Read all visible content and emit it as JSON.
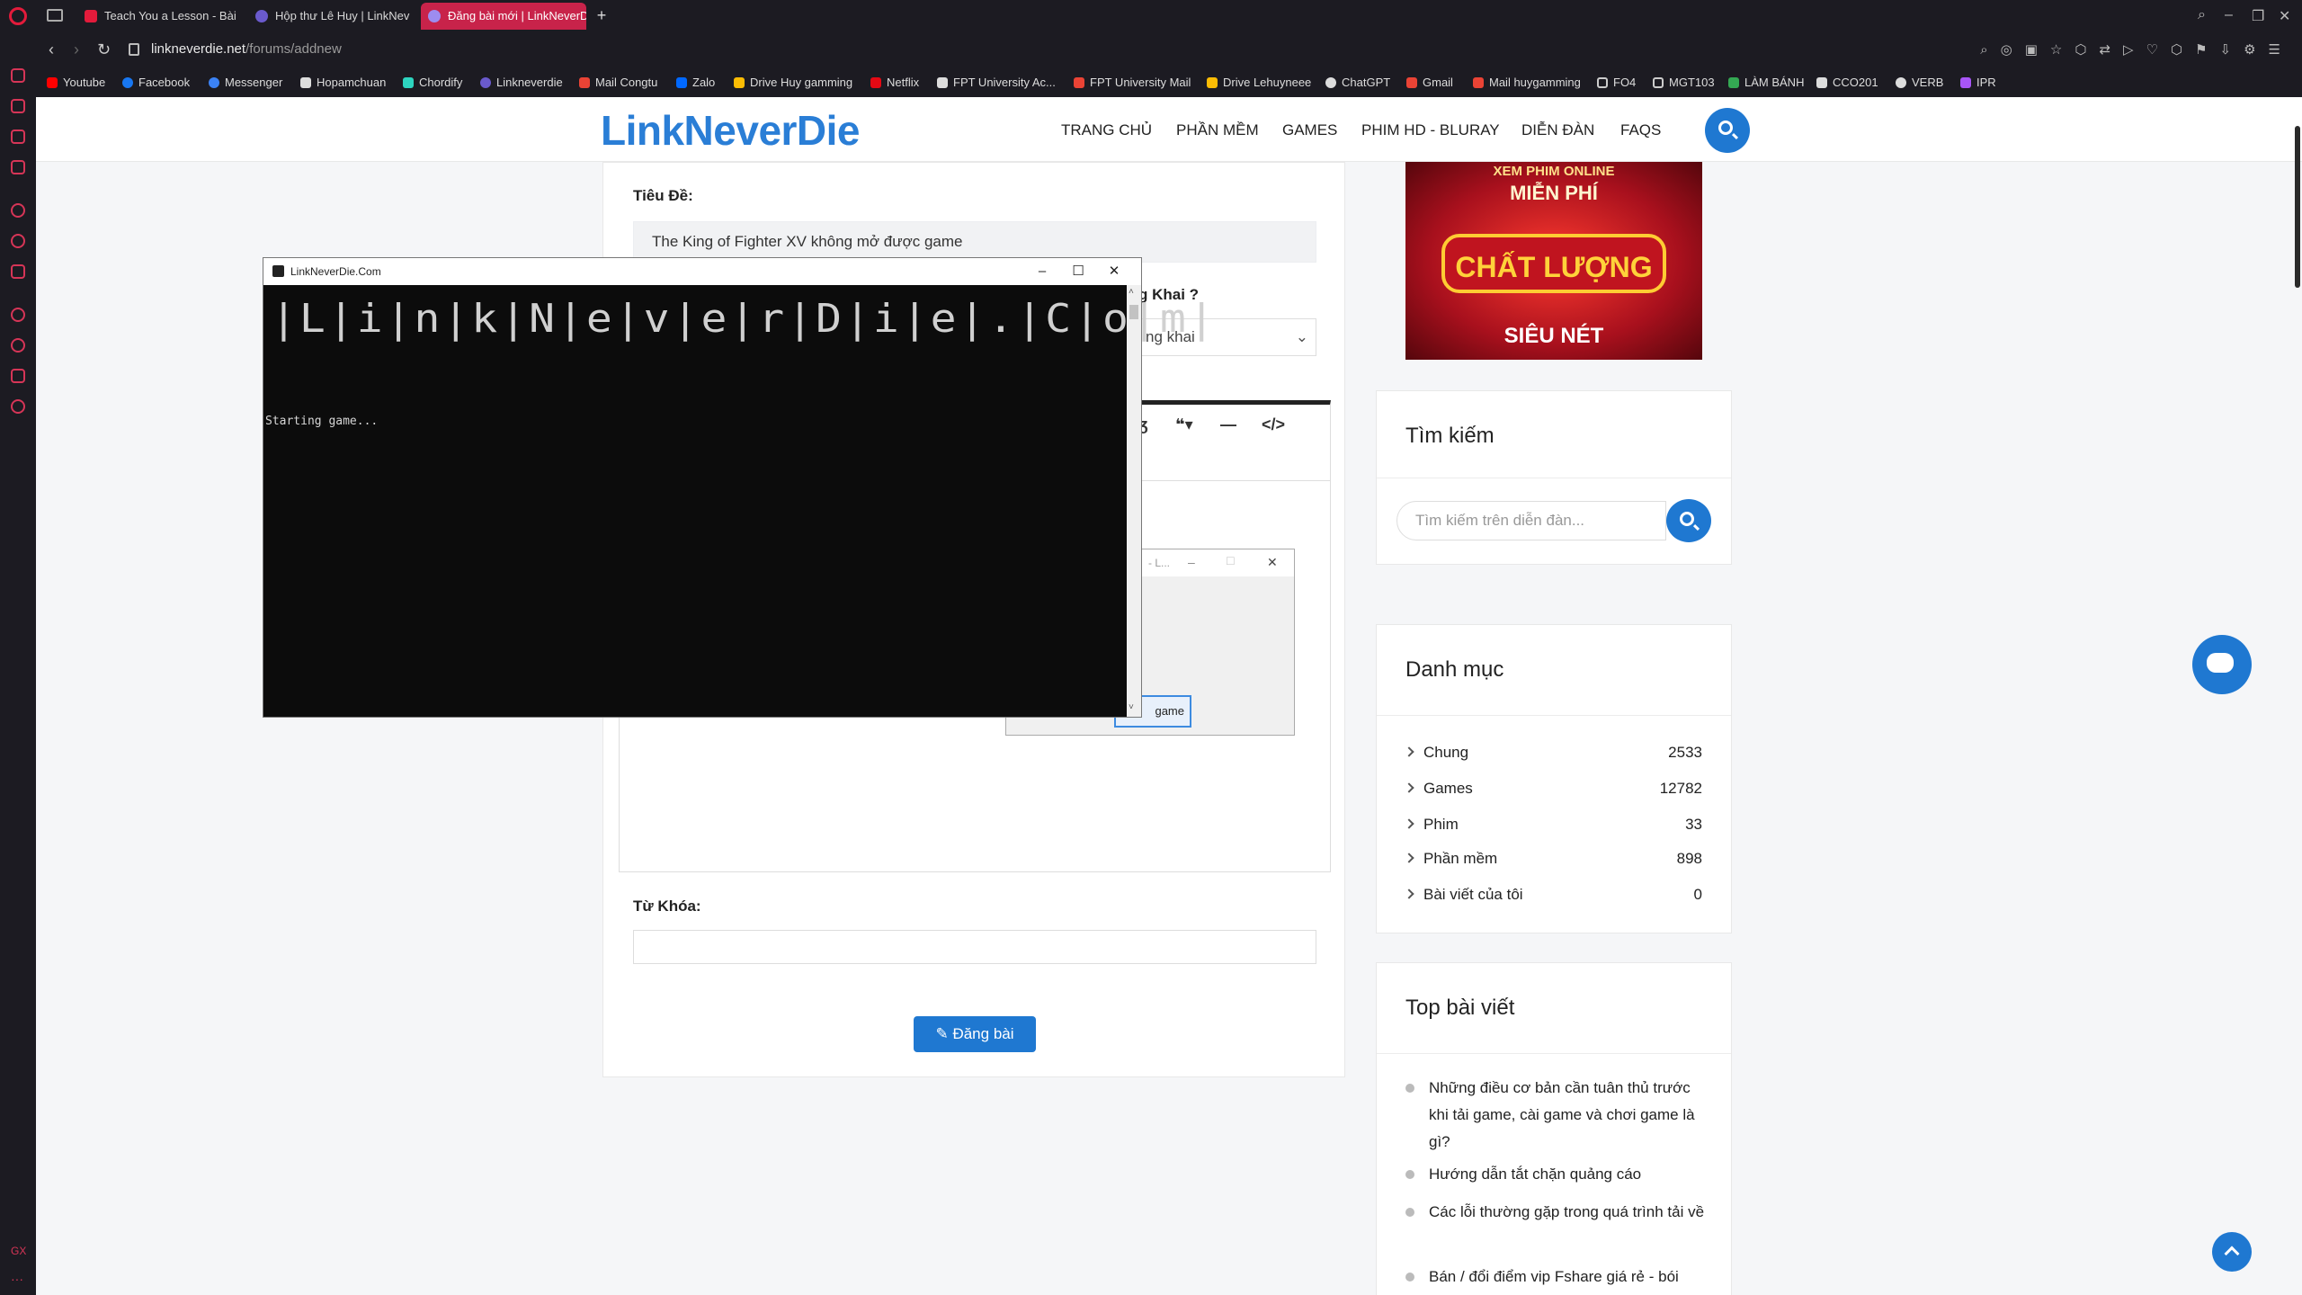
{
  "browser": {
    "tabs": [
      {
        "label": "Teach You a Lesson - Bài",
        "color": "#e31b3b"
      },
      {
        "label": "Hộp thư Lê Huy | LinkNev",
        "color": "#6a5acd"
      },
      {
        "label": "Đăng bài mới | LinkNeverD",
        "color": "#6a5acd"
      }
    ],
    "url_host": "linkneverdie.net",
    "url_path": "/forums/addnew",
    "bookmarks": [
      {
        "label": "Youtube",
        "color": "#ff0000"
      },
      {
        "label": "Facebook",
        "color": "#1877f2"
      },
      {
        "label": "Messenger",
        "color": "#3b82f6"
      },
      {
        "label": "Hopamchuan",
        "color": "#dddddd"
      },
      {
        "label": "Chordify",
        "color": "#2dd4bf"
      },
      {
        "label": "Linkneverdie",
        "color": "#6a5acd"
      },
      {
        "label": "Mail Congtu",
        "color": "#ea4335"
      },
      {
        "label": "Zalo",
        "color": "#0068ff"
      },
      {
        "label": "Drive Huy gamming",
        "color": "#fbbc04"
      },
      {
        "label": "Netflix",
        "color": "#e50914"
      },
      {
        "label": "FPT University Ac...",
        "color": "#dddddd"
      },
      {
        "label": "FPT University Mail",
        "color": "#ea4335"
      },
      {
        "label": "Drive Lehuyneee",
        "color": "#fbbc04"
      },
      {
        "label": "ChatGPT",
        "color": "#dddddd"
      },
      {
        "label": "Gmail",
        "color": "#ea4335"
      },
      {
        "label": "Mail huygamming",
        "color": "#ea4335"
      },
      {
        "label": "FO4",
        "color": "#cccccc"
      },
      {
        "label": "MGT103",
        "color": "#cccccc"
      },
      {
        "label": "LÀM BÁNH",
        "color": "#34a853"
      },
      {
        "label": "CCO201",
        "color": "#dddddd"
      },
      {
        "label": "VERB",
        "color": "#dddddd"
      },
      {
        "label": "IPR",
        "color": "#a855f7"
      }
    ]
  },
  "site": {
    "logo": "LinkNeverDie",
    "nav": [
      "TRANG CHỦ",
      "PHẦN MỀM",
      "GAMES",
      "PHIM HD - BLURAY",
      "DIỄN ĐÀN",
      "FAQS"
    ],
    "brand_color": "#1f78d1"
  },
  "form": {
    "title_label": "Tiêu Đề:",
    "title_value": "The King of Fighter XV không mở được game",
    "visibility_label": "g Khai ?",
    "visibility_value": "ng khai",
    "keywords_label": "Từ Khóa:",
    "keywords_value": "",
    "submit_label": "Đăng bài"
  },
  "banner": {
    "line1": "XEM PHIM ONLINE",
    "line2": "MIỄN PHÍ",
    "line3": "CHẤT LƯỢNG",
    "line4": "SIÊU NÉT"
  },
  "search_widget": {
    "title": "Tìm kiếm",
    "placeholder": "Tìm kiếm trên diễn đàn..."
  },
  "category_widget": {
    "title": "Danh mục",
    "items": [
      {
        "label": "Chung",
        "count": "2533"
      },
      {
        "label": "Games",
        "count": "12782"
      },
      {
        "label": "Phim",
        "count": "33"
      },
      {
        "label": "Phần mềm",
        "count": "898"
      },
      {
        "label": "Bài viết của tôi",
        "count": "0"
      }
    ]
  },
  "top_widget": {
    "title": "Top bài viết",
    "items": [
      "Những điều cơ bản cần tuân thủ trước khi tải game, cài game và chơi game là gì?",
      "Hướng dẫn tắt chặn quảng cáo",
      "Các lỗi thường gặp trong quá trình tải về",
      "Bán / đổi điểm vip Fshare giá rẻ - bói"
    ]
  },
  "console": {
    "title": "LinkNeverDie.Com",
    "ascii_art": "|L|i|n|k|N|e|v|e|r|D|i|e|.|C|o|m|",
    "output": "Starting game...",
    "min": "–",
    "max": "☐",
    "close": "✕"
  },
  "dialog": {
    "title_fragment": "- L...",
    "button_label": "game"
  }
}
